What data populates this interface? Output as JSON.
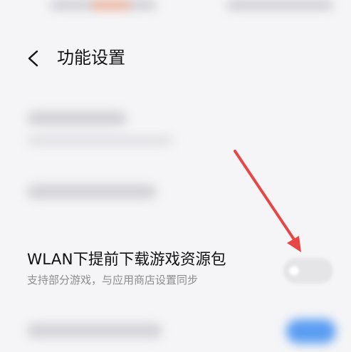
{
  "header": {
    "title": "功能设置",
    "back_icon": "chevron-left-icon"
  },
  "settings": [
    {
      "id": "wlan-preload",
      "title": "WLAN下提前下载游戏资源包",
      "subtitle": "支持部分游戏，与应用商店设置同步",
      "enabled": false
    }
  ],
  "colors": {
    "background": "#f5f5f7",
    "title_text": "#111111",
    "subtitle_text": "#8c8c92",
    "toggle_off": "#e5e5e8",
    "toggle_on": "#5b9df2",
    "annotation_arrow": "#e84545"
  }
}
